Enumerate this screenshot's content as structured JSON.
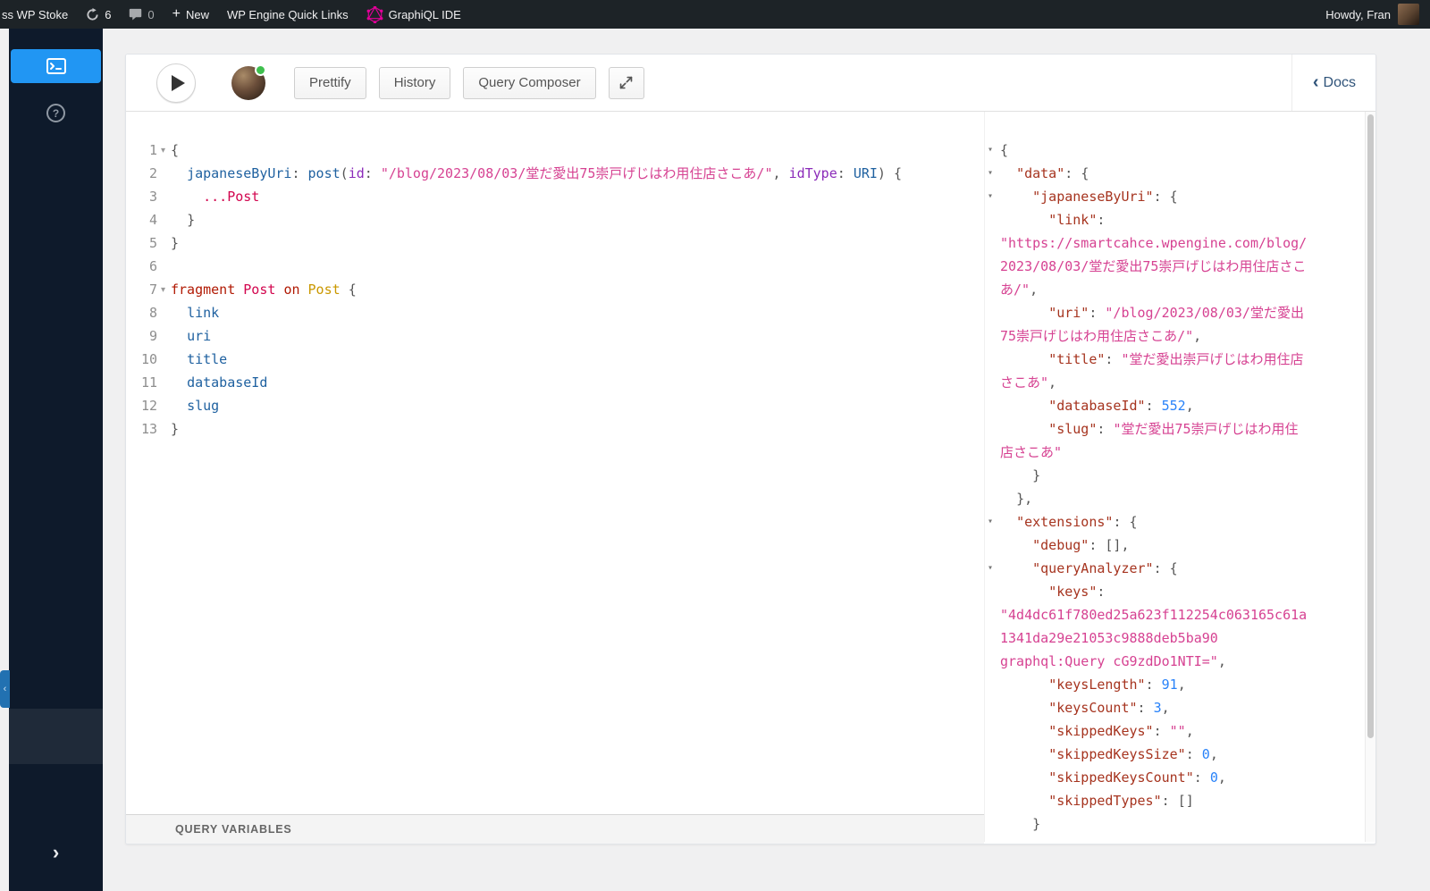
{
  "admin_bar": {
    "site_name": "ss WP Stoke",
    "update_count": "6",
    "comment_count": "0",
    "new_label": "New",
    "wpe_quick_links": "WP Engine Quick Links",
    "graphiql_ide": "GraphiQL IDE",
    "howdy": "Howdy, Fran"
  },
  "icons": {
    "plus": "+",
    "chevron_left": "‹",
    "help": "?",
    "collapse": "›",
    "fold": "▾"
  },
  "toolbar": {
    "prettify": "Prettify",
    "history": "History",
    "query_composer": "Query Composer",
    "docs": "Docs"
  },
  "variables_bar": {
    "title": "QUERY VARIABLES"
  },
  "colors": {
    "graphql_pink": "#E10098",
    "admin_bar_bg": "#1D2327",
    "activity_bar_bg": "#0E1A2B",
    "active_item_blue": "#2196F3",
    "wp_blue": "#2271B1",
    "avatar_status_green": "#3FBF4E",
    "syntax_property": "#1F61A0",
    "syntax_attribute": "#8B2BB9",
    "syntax_string": "#D64292",
    "syntax_keyword": "#B11A04",
    "syntax_fragment": "#D2054E",
    "syntax_type": "#CA9800",
    "syntax_number": "#2882F9",
    "result_key": "#A6341F"
  },
  "editor": {
    "lines": [
      {
        "n": "1",
        "fold": true,
        "tokens": [
          [
            "{",
            "pun"
          ]
        ]
      },
      {
        "n": "2",
        "tokens": [
          [
            "  ",
            ""
          ],
          [
            "japaneseByUri",
            "prop"
          ],
          [
            ":",
            "pun"
          ],
          [
            " ",
            ""
          ],
          [
            "post",
            "prop"
          ],
          [
            "(",
            "pun"
          ],
          [
            "id",
            "attr"
          ],
          [
            ":",
            "pun"
          ],
          [
            " ",
            ""
          ],
          [
            "\"/blog/2023/08/03/堂だ愛出75崇戸げじはわ用住店さこあ/\"",
            "str"
          ],
          [
            ",",
            "pun"
          ],
          [
            " ",
            ""
          ],
          [
            "idType",
            "attr"
          ],
          [
            ":",
            "pun"
          ],
          [
            " ",
            ""
          ],
          [
            "URI",
            "enum"
          ],
          [
            ")",
            "pun"
          ],
          [
            " ",
            ""
          ],
          [
            "{",
            "pun"
          ]
        ]
      },
      {
        "n": "3",
        "tokens": [
          [
            "    ",
            ""
          ],
          [
            "...Post",
            "def"
          ]
        ]
      },
      {
        "n": "4",
        "tokens": [
          [
            "  ",
            ""
          ],
          [
            "}",
            "pun"
          ]
        ]
      },
      {
        "n": "5",
        "tokens": [
          [
            "}",
            "pun"
          ]
        ]
      },
      {
        "n": "6",
        "tokens": []
      },
      {
        "n": "7",
        "fold": true,
        "tokens": [
          [
            "fragment",
            "kw"
          ],
          [
            " ",
            ""
          ],
          [
            "Post",
            "def"
          ],
          [
            " ",
            ""
          ],
          [
            "on",
            "kw"
          ],
          [
            " ",
            ""
          ],
          [
            "Post",
            "type"
          ],
          [
            " ",
            ""
          ],
          [
            "{",
            "pun"
          ]
        ]
      },
      {
        "n": "8",
        "tokens": [
          [
            "  ",
            ""
          ],
          [
            "link",
            "prop"
          ]
        ]
      },
      {
        "n": "9",
        "tokens": [
          [
            "  ",
            ""
          ],
          [
            "uri",
            "prop"
          ]
        ]
      },
      {
        "n": "10",
        "tokens": [
          [
            "  ",
            ""
          ],
          [
            "title",
            "prop"
          ]
        ]
      },
      {
        "n": "11",
        "tokens": [
          [
            "  ",
            ""
          ],
          [
            "databaseId",
            "prop"
          ]
        ]
      },
      {
        "n": "12",
        "tokens": [
          [
            "  ",
            ""
          ],
          [
            "slug",
            "prop"
          ]
        ]
      },
      {
        "n": "13",
        "tokens": [
          [
            "}",
            "pun"
          ]
        ]
      }
    ]
  },
  "result": {
    "lines": [
      {
        "fold": true,
        "tokens": [
          [
            "{",
            "pun"
          ]
        ]
      },
      {
        "fold": true,
        "tokens": [
          [
            "  ",
            ""
          ],
          [
            "\"data\"",
            "key"
          ],
          [
            ": ",
            "pun"
          ],
          [
            "{",
            "pun"
          ]
        ]
      },
      {
        "fold": true,
        "tokens": [
          [
            "    ",
            ""
          ],
          [
            "\"japaneseByUri\"",
            "key"
          ],
          [
            ": ",
            "pun"
          ],
          [
            "{",
            "pun"
          ]
        ]
      },
      {
        "tokens": [
          [
            "      ",
            ""
          ],
          [
            "\"link\"",
            "key"
          ],
          [
            ":",
            "pun"
          ]
        ]
      },
      {
        "tokens": [
          [
            "\"https://smartcahce.wpengine.com/blog/",
            "str"
          ]
        ]
      },
      {
        "tokens": [
          [
            "2023/08/03/堂だ愛出75崇戸げじはわ用住店さこ",
            "str"
          ]
        ]
      },
      {
        "tokens": [
          [
            "あ/\"",
            "str"
          ],
          [
            ",",
            "pun"
          ]
        ]
      },
      {
        "tokens": [
          [
            "      ",
            ""
          ],
          [
            "\"uri\"",
            "key"
          ],
          [
            ": ",
            "pun"
          ],
          [
            "\"/blog/2023/08/03/堂だ愛出",
            "str"
          ]
        ]
      },
      {
        "tokens": [
          [
            "75崇戸げじはわ用住店さこあ/\"",
            "str"
          ],
          [
            ",",
            "pun"
          ]
        ]
      },
      {
        "tokens": [
          [
            "      ",
            ""
          ],
          [
            "\"title\"",
            "key"
          ],
          [
            ": ",
            "pun"
          ],
          [
            "\"堂だ愛出崇戸げじはわ用住店",
            "str"
          ]
        ]
      },
      {
        "tokens": [
          [
            "さこあ\"",
            "str"
          ],
          [
            ",",
            "pun"
          ]
        ]
      },
      {
        "tokens": [
          [
            "      ",
            ""
          ],
          [
            "\"databaseId\"",
            "key"
          ],
          [
            ": ",
            "pun"
          ],
          [
            "552",
            "num"
          ],
          [
            ",",
            "pun"
          ]
        ]
      },
      {
        "tokens": [
          [
            "      ",
            ""
          ],
          [
            "\"slug\"",
            "key"
          ],
          [
            ": ",
            "pun"
          ],
          [
            "\"堂だ愛出75崇戸げじはわ用住",
            "str"
          ]
        ]
      },
      {
        "tokens": [
          [
            "店さこあ\"",
            "str"
          ]
        ]
      },
      {
        "tokens": [
          [
            "    ",
            ""
          ],
          [
            "}",
            "pun"
          ]
        ]
      },
      {
        "tokens": [
          [
            "  ",
            ""
          ],
          [
            "},",
            "pun"
          ]
        ]
      },
      {
        "fold": true,
        "tokens": [
          [
            "  ",
            ""
          ],
          [
            "\"extensions\"",
            "key"
          ],
          [
            ": ",
            "pun"
          ],
          [
            "{",
            "pun"
          ]
        ]
      },
      {
        "tokens": [
          [
            "    ",
            ""
          ],
          [
            "\"debug\"",
            "key"
          ],
          [
            ": ",
            "pun"
          ],
          [
            "[],",
            "pun"
          ]
        ]
      },
      {
        "fold": true,
        "tokens": [
          [
            "    ",
            ""
          ],
          [
            "\"queryAnalyzer\"",
            "key"
          ],
          [
            ": ",
            "pun"
          ],
          [
            "{",
            "pun"
          ]
        ]
      },
      {
        "tokens": [
          [
            "      ",
            ""
          ],
          [
            "\"keys\"",
            "key"
          ],
          [
            ":",
            "pun"
          ]
        ]
      },
      {
        "tokens": [
          [
            "\"4d4dc61f780ed25a623f112254c063165c61a",
            "str"
          ]
        ]
      },
      {
        "tokens": [
          [
            "1341da29e21053c9888deb5ba90",
            "str"
          ]
        ]
      },
      {
        "tokens": [
          [
            "graphql:Query cG9zdDo1NTI=\"",
            "str"
          ],
          [
            ",",
            "pun"
          ]
        ]
      },
      {
        "tokens": [
          [
            "      ",
            ""
          ],
          [
            "\"keysLength\"",
            "key"
          ],
          [
            ": ",
            "pun"
          ],
          [
            "91",
            "num"
          ],
          [
            ",",
            "pun"
          ]
        ]
      },
      {
        "tokens": [
          [
            "      ",
            ""
          ],
          [
            "\"keysCount\"",
            "key"
          ],
          [
            ": ",
            "pun"
          ],
          [
            "3",
            "num"
          ],
          [
            ",",
            "pun"
          ]
        ]
      },
      {
        "tokens": [
          [
            "      ",
            ""
          ],
          [
            "\"skippedKeys\"",
            "key"
          ],
          [
            ": ",
            "pun"
          ],
          [
            "\"\"",
            "str"
          ],
          [
            ",",
            "pun"
          ]
        ]
      },
      {
        "tokens": [
          [
            "      ",
            ""
          ],
          [
            "\"skippedKeysSize\"",
            "key"
          ],
          [
            ": ",
            "pun"
          ],
          [
            "0",
            "num"
          ],
          [
            ",",
            "pun"
          ]
        ]
      },
      {
        "tokens": [
          [
            "      ",
            ""
          ],
          [
            "\"skippedKeysCount\"",
            "key"
          ],
          [
            ": ",
            "pun"
          ],
          [
            "0",
            "num"
          ],
          [
            ",",
            "pun"
          ]
        ]
      },
      {
        "tokens": [
          [
            "      ",
            ""
          ],
          [
            "\"skippedTypes\"",
            "key"
          ],
          [
            ": ",
            "pun"
          ],
          [
            "[]",
            "pun"
          ]
        ]
      },
      {
        "tokens": [
          [
            "    ",
            ""
          ],
          [
            "}",
            "pun"
          ]
        ]
      }
    ]
  }
}
